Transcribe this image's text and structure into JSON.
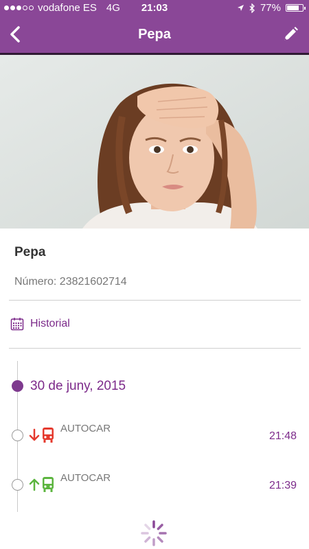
{
  "status_bar": {
    "carrier": "vodafone ES",
    "network": "4G",
    "time": "21:03",
    "battery": "77%",
    "battery_level": 0.77
  },
  "nav": {
    "title": "Pepa",
    "back_icon": "chevron-left-icon",
    "edit_icon": "pencil-icon"
  },
  "profile": {
    "name": "Pepa",
    "number": "Número: 23821602714"
  },
  "historial": {
    "label": "Historial",
    "icon": "calendar-icon"
  },
  "timeline": {
    "date": "30 de juny, 2015",
    "events": [
      {
        "label": "AUTOCAR",
        "time": "21:48",
        "direction": "down",
        "color": "#e53a2e",
        "icon": "bus-icon"
      },
      {
        "label": "AUTOCAR",
        "time": "21:39",
        "direction": "up",
        "color": "#5cb53f",
        "icon": "bus-icon"
      }
    ]
  },
  "colors": {
    "brand": "#8a4797",
    "accent_text": "#7c2a8a"
  }
}
